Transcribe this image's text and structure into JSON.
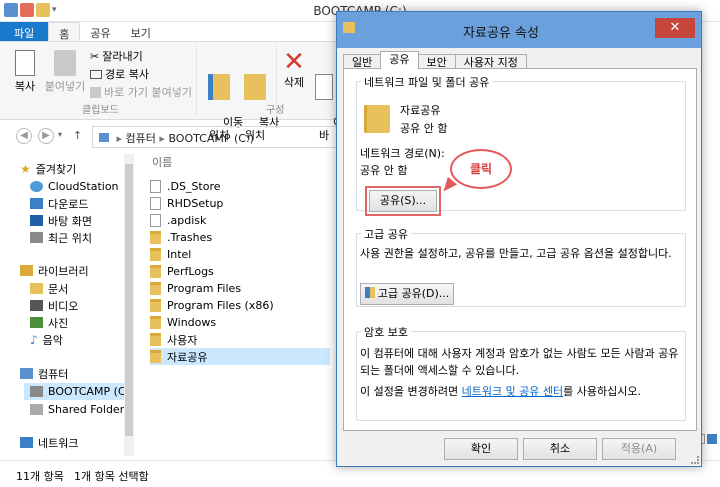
{
  "explorer": {
    "title": "BOOTCAMP (C:)",
    "ribbon_tabs": [
      "파일",
      "홈",
      "공유",
      "보기"
    ],
    "clipboard": {
      "copy": "복사",
      "paste": "붙여넣기",
      "cut": "잘라내기",
      "copy_path": "경로 복사",
      "paste_shortcut": "바로 가기 붙여넣기",
      "group_label": "클립보드"
    },
    "organize": {
      "move_to": "이동\n위치",
      "copy_to": "복사\n위치",
      "delete": "삭제",
      "rename": "이\n바",
      "group_label": "구성"
    },
    "address": {
      "path": [
        "컴퓨터",
        "BOOTCAMP (C:)"
      ]
    },
    "nav": {
      "favorites": "즐겨찾기",
      "items": [
        "CloudStation",
        "다운로드",
        "바탕 화면",
        "최근 위치"
      ],
      "libraries": "라이브러리",
      "lib_items": [
        "문서",
        "비디오",
        "사진",
        "음악"
      ],
      "computer": "컴퓨터",
      "comp_items": [
        "BOOTCAMP (C:)",
        "Shared Folders(₩"
      ],
      "network": "네트워크"
    },
    "list": {
      "column_name": "이름",
      "files": [
        ".DS_Store",
        "RHDSetup",
        ".apdisk",
        ".Trashes",
        "Intel",
        "PerfLogs",
        "Program Files",
        "Program Files (x86)",
        "Windows",
        "사용자",
        "자료공유"
      ]
    },
    "status": {
      "count": "11개 항목",
      "selected": "1개 항목 선택함"
    }
  },
  "dialog": {
    "title": "자료공유 속성",
    "tabs": [
      "일반",
      "공유",
      "보안",
      "사용자 지정"
    ],
    "network_sharing": {
      "legend": "네트워크 파일 및 폴더 공유",
      "folder_name": "자료공유",
      "folder_state": "공유 안 함",
      "path_label": "네트워크 경로(N):",
      "path_value": "공유 안 함",
      "share_button": "공유(S)..."
    },
    "advanced_sharing": {
      "legend": "고급 공유",
      "description": "사용 권한을 설정하고, 공유를 만들고, 고급 공유 옵션을 설정합니다.",
      "button": "고급 공유(D)..."
    },
    "password_protection": {
      "legend": "암호 보호",
      "description": "이 컴퓨터에 대해 사용자 계정과 암호가 없는 사람도 모든 사람과 공유되는 폴더에 액세스할 수 있습니다.",
      "change_prefix": "이 설정을 변경하려면 ",
      "change_link": "네트워크 및 공유 센터",
      "change_suffix": "를 사용하십시오."
    },
    "buttons": {
      "ok": "확인",
      "cancel": "취소",
      "apply": "적용(A)"
    },
    "callout": "클릭"
  }
}
